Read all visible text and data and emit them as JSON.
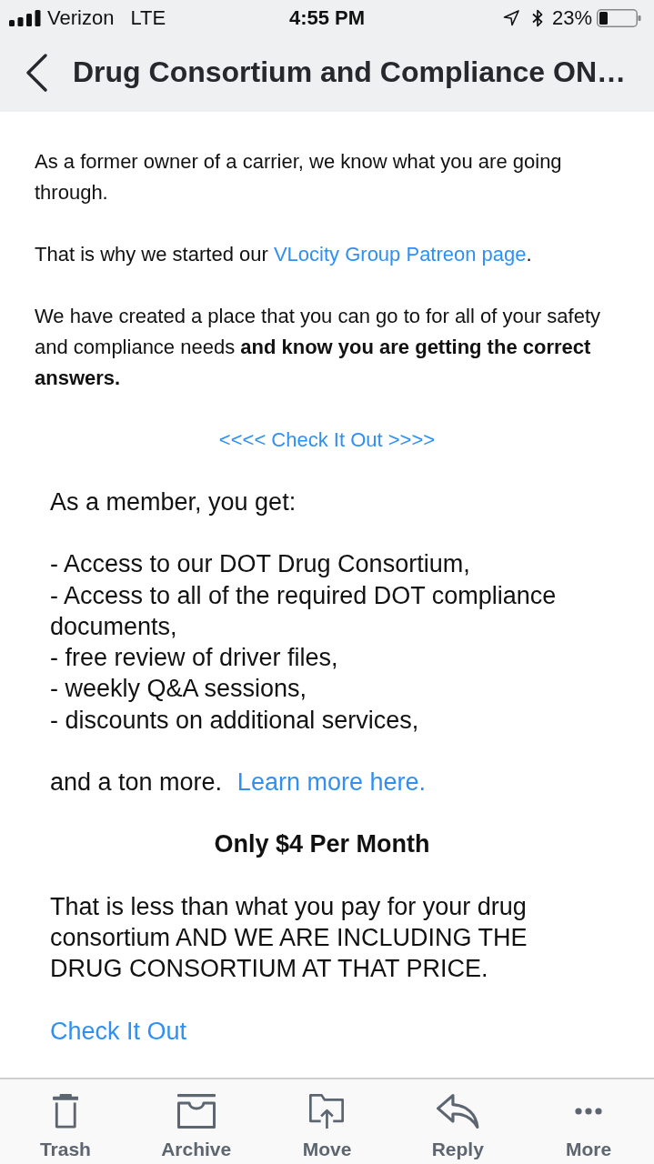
{
  "status_bar": {
    "carrier": "Verizon",
    "network": "LTE",
    "time": "4:55 PM",
    "battery": "23%"
  },
  "header": {
    "title": "Drug Consortium and Compliance ON…"
  },
  "message": {
    "intro": [
      {
        "kind": "paragraph",
        "text": "As a former owner of a carrier, we know what you are going through."
      },
      {
        "kind": "paragraph",
        "text": "That is why we started our",
        "link": "VLocity Group Patreon page",
        "after": "."
      },
      {
        "kind": "paragraph",
        "text": "We have created a place that you can go to for all of your safety and compliance needs **and know you are getting the correct answers.**"
      },
      {
        "kind": "center_link",
        "link": "<<<< Check It Out >>>>"
      }
    ],
    "offer": [
      {
        "kind": "paragraph",
        "text": "As a member, you get:"
      },
      {
        "kind": "list",
        "items": [
          "- Access to our DOT Drug Consortium,",
          "- Access to all of the required DOT compliance documents,",
          "- free review of driver files,",
          "- weekly Q&A sessions,",
          "- discounts on additional services,"
        ]
      },
      {
        "kind": "paragraph",
        "text": "and a ton more.",
        "link": "Learn more here."
      },
      {
        "kind": "heading",
        "text": "Only $4 Per Month"
      },
      {
        "kind": "paragraph",
        "text": "That is less than what you pay for your drug consortium AND WE ARE INCLUDING THE DRUG CONSORTIUM AT THAT PRICE."
      },
      {
        "kind": "link",
        "link": "Check It Out"
      }
    ]
  },
  "toolbar": {
    "items": [
      {
        "label": "Trash"
      },
      {
        "label": "Archive"
      },
      {
        "label": "Move"
      },
      {
        "label": "Reply"
      },
      {
        "label": "More"
      }
    ]
  }
}
